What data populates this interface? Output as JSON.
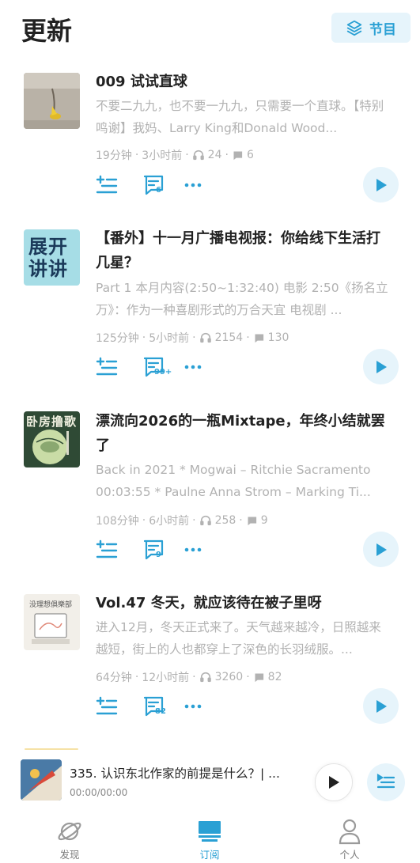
{
  "header": {
    "title": "更新",
    "programs_label": "节目"
  },
  "episodes": [
    {
      "title": "009 试试直球",
      "desc": "不要二九九，也不要一九九，只需要一个直球。【特别鸣谢】我妈、Larry King和Donald Wood...",
      "duration": "19分钟",
      "time": "3小时前",
      "listens": "24",
      "comments": "6",
      "comment_badge": "6"
    },
    {
      "title": "【番外】十一月广播电视报：你给线下生活打几星？",
      "desc": "Part 1 本月内容(2:50~1:32:40) 电影 2:50《扬名立万》：作为一种喜剧形式的万合天宜 电视剧 ...",
      "duration": "125分钟",
      "time": "5小时前",
      "listens": "2154",
      "comments": "130",
      "comment_badge": "99+",
      "cover_text": "展开讲讲"
    },
    {
      "title": "漂流向2026的一瓶Mixtape，年终小结就罢了",
      "desc": "Back in 2021 * Mogwai – Ritchie Sacramento 00:03:55 * Paulne Anna Strom – Marking Ti...",
      "duration": "108分钟",
      "time": "6小时前",
      "listens": "258",
      "comments": "9",
      "comment_badge": "9",
      "cover_text": "卧房撸歌"
    },
    {
      "title": "Vol.47 冬天，就应该待在被子里呀",
      "desc": "进入12月，冬天正式来了。天气越来越冷，日照越来越短，街上的人也都穿上了深色的长羽绒服。...",
      "duration": "64分钟",
      "time": "12小时前",
      "listens": "3260",
      "comments": "82",
      "comment_badge": "82",
      "cover_text": "没理想俱樂部"
    }
  ],
  "player": {
    "title": "335. 认识东北作家的前提是什么？| ...",
    "time": "00:00/00:00"
  },
  "tabs": [
    {
      "label": "发现",
      "icon": "planet-icon"
    },
    {
      "label": "订阅",
      "icon": "subscribe-icon",
      "active": true
    },
    {
      "label": "个人",
      "icon": "person-icon"
    }
  ],
  "colors": {
    "accent": "#2aa0d4",
    "accent_bg": "#e6f4fb",
    "muted": "#b2b2b2"
  }
}
